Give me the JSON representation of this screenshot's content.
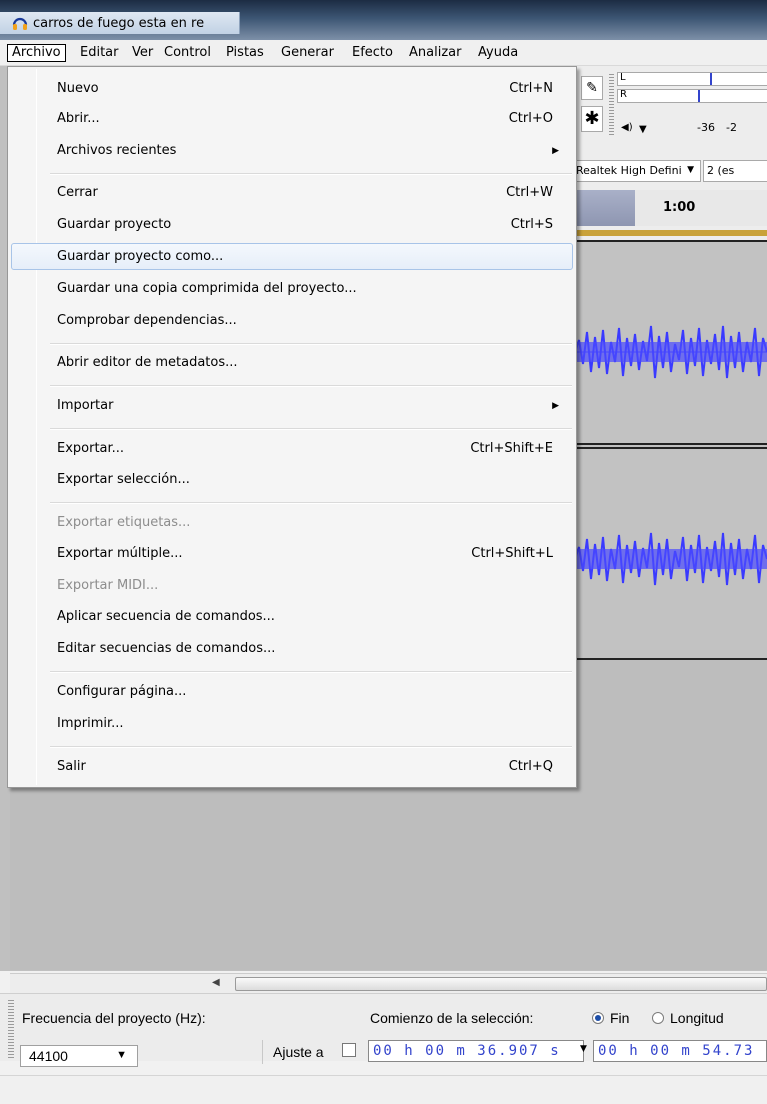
{
  "window": {
    "title": "carros de fuego esta en re"
  },
  "menubar": {
    "items": [
      {
        "label": "Archivo"
      },
      {
        "label": "Editar"
      },
      {
        "label": "Ver"
      },
      {
        "label": "Control"
      },
      {
        "label": "Pistas"
      },
      {
        "label": "Generar"
      },
      {
        "label": "Efecto"
      },
      {
        "label": "Analizar"
      },
      {
        "label": "Ayuda"
      }
    ],
    "active": "Archivo"
  },
  "file_menu": {
    "items": [
      {
        "label": "Nuevo",
        "shortcut": "Ctrl+N"
      },
      {
        "label": "Abrir...",
        "shortcut": "Ctrl+O"
      },
      {
        "label": "Archivos recientes",
        "submenu": "▶"
      },
      {
        "label": "Cerrar",
        "shortcut": "Ctrl+W"
      },
      {
        "label": "Guardar proyecto",
        "shortcut": "Ctrl+S"
      },
      {
        "label": "Guardar proyecto como...",
        "highlighted": true
      },
      {
        "label": "Guardar una copia comprimida del proyecto..."
      },
      {
        "label": "Comprobar dependencias..."
      },
      {
        "label": "Abrir editor de metadatos..."
      },
      {
        "label": "Importar",
        "submenu": "▶"
      },
      {
        "label": "Exportar...",
        "shortcut": "Ctrl+Shift+E"
      },
      {
        "label": "Exportar selección..."
      },
      {
        "label": "Exportar etiquetas...",
        "disabled": true
      },
      {
        "label": "Exportar múltiple...",
        "shortcut": "Ctrl+Shift+L"
      },
      {
        "label": "Exportar MIDI...",
        "disabled": true
      },
      {
        "label": "Aplicar secuencia de comandos..."
      },
      {
        "label": "Editar secuencias de comandos..."
      },
      {
        "label": "Configurar página..."
      },
      {
        "label": "Imprimir..."
      },
      {
        "label": "Salir",
        "shortcut": "Ctrl+Q"
      }
    ]
  },
  "toolbar": {
    "meter_left": "L",
    "meter_right": "R",
    "meter_value": "-36",
    "meter_value2": "-2",
    "device": "Realtek High Defini",
    "channels": "2 (es",
    "timeline_label": "1:00",
    "pencil_icon": "✎",
    "multi_icon": "✱",
    "speaker_icon": "◀)",
    "dropdown_arrow": "▼"
  },
  "selection_bar": {
    "rate_label": "Frecuencia del proyecto (Hz):",
    "rate_value": "44100",
    "snap_label": "Ajuste a",
    "start_label": "Comienzo de la selección:",
    "end_option": "Fin",
    "length_option": "Longitud",
    "start_time": "00 h 00 m 36.907 s",
    "end_time": "00 h 00 m 54.73",
    "dropdown_arrow": "▼",
    "scroll_left": "◀"
  },
  "colors": {
    "waveform": "#3a3aff",
    "selection_blue": "#3344cc",
    "menu_highlight_border": "#a8c4e8"
  }
}
